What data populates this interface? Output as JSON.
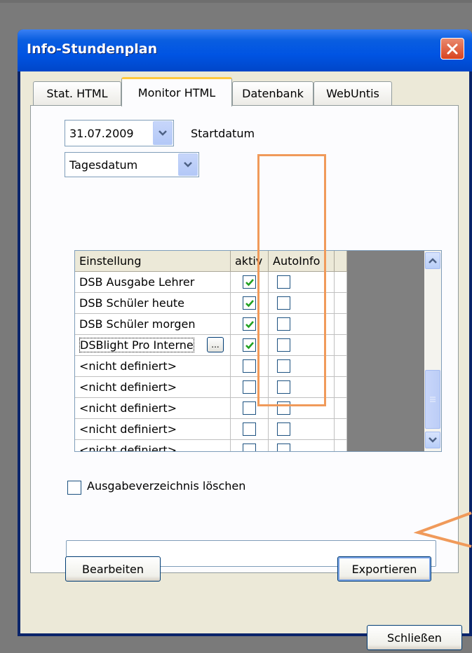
{
  "window": {
    "title": "Info-Stundenplan",
    "close_icon": "close-icon"
  },
  "tabs": [
    {
      "label": "Stat. HTML",
      "active": false
    },
    {
      "label": "Monitor HTML",
      "active": true
    },
    {
      "label": "Datenbank",
      "active": false
    },
    {
      "label": "WebUntis",
      "active": false
    }
  ],
  "start_date": {
    "value": "31.07.2009",
    "label": "Startdatum"
  },
  "date_mode": {
    "value": "Tagesdatum"
  },
  "grid": {
    "columns": [
      "Einstellung",
      "aktiv",
      "AutoInfo"
    ],
    "rows": [
      {
        "name": "DSB Ausgabe Lehrer",
        "aktiv": true,
        "autoinfo": false
      },
      {
        "name": "DSB Schüler heute",
        "aktiv": true,
        "autoinfo": false
      },
      {
        "name": "DSB Schüler morgen",
        "aktiv": true,
        "autoinfo": false
      },
      {
        "name": "DSBlight Pro Interne",
        "aktiv": true,
        "autoinfo": false,
        "has_ellipsis": true,
        "ellipsis_label": "..."
      },
      {
        "name": "<nicht definiert>",
        "aktiv": false,
        "autoinfo": false
      },
      {
        "name": "<nicht definiert>",
        "aktiv": false,
        "autoinfo": false
      },
      {
        "name": "<nicht definiert>",
        "aktiv": false,
        "autoinfo": false
      },
      {
        "name": "<nicht definiert>",
        "aktiv": false,
        "autoinfo": false
      },
      {
        "name": "<nicht definiert>",
        "aktiv": false,
        "autoinfo": false
      }
    ]
  },
  "options": {
    "delete_output_dir_label": "Ausgabeverzeichnis löschen",
    "delete_output_dir_checked": false
  },
  "path_field": {
    "value": ""
  },
  "buttons": {
    "edit": "Bearbeiten",
    "export": "Exportieren",
    "close": "Schließen"
  },
  "annotation_color": "#f09a5a"
}
